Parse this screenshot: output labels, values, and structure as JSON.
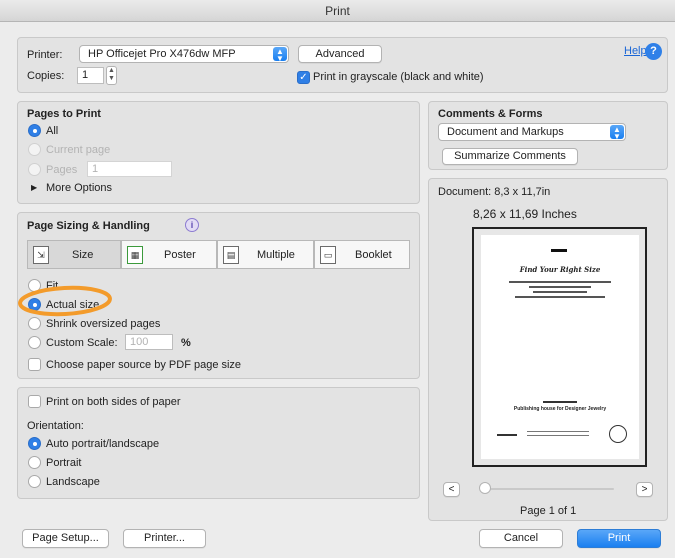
{
  "window": {
    "title": "Print"
  },
  "printer": {
    "label": "Printer:",
    "value": "HP Officejet Pro X476dw MFP",
    "advanced_label": "Advanced",
    "help_label": "Help",
    "copies_label": "Copies:",
    "copies_value": "1",
    "grayscale_label": "Print in grayscale (black and white)",
    "grayscale_checked": true
  },
  "pages_to_print": {
    "title": "Pages to Print",
    "all_label": "All",
    "current_label": "Current page",
    "pages_label": "Pages",
    "pages_value": "1",
    "more_label": "More Options"
  },
  "sizing": {
    "title": "Page Sizing & Handling",
    "tabs": [
      "Size",
      "Poster",
      "Multiple",
      "Booklet"
    ],
    "selected_tab": "Size",
    "fit_label": "Fit",
    "actual_label": "Actual size",
    "shrink_label": "Shrink oversized pages",
    "custom_label": "Custom Scale:",
    "custom_value": "100",
    "percent_label": "%",
    "paper_source_label": "Choose paper source by PDF page size",
    "selected_option": "Actual size"
  },
  "duplex": {
    "both_sides_label": "Print on both sides of paper",
    "orientation_label": "Orientation:",
    "auto_label": "Auto portrait/landscape",
    "portrait_label": "Portrait",
    "landscape_label": "Landscape",
    "selected_orientation": "Auto portrait/landscape"
  },
  "comments": {
    "title": "Comments & Forms",
    "value": "Document and Markups",
    "summarize_label": "Summarize Comments"
  },
  "preview": {
    "document_label": "Document: 8,3 x 11,7in",
    "size_label": "8,26 x 11,69 Inches",
    "page_title": "Find Your Right Size",
    "page_footer": "Publishing house for Designer Jewelry",
    "page_indicator": "Page 1 of 1",
    "prev_label": "<",
    "next_label": ">"
  },
  "footer": {
    "page_setup_label": "Page Setup...",
    "printer_label": "Printer...",
    "cancel_label": "Cancel",
    "print_label": "Print"
  },
  "colors": {
    "accent": "#1a7ff0",
    "annotation": "#f39b2b"
  }
}
